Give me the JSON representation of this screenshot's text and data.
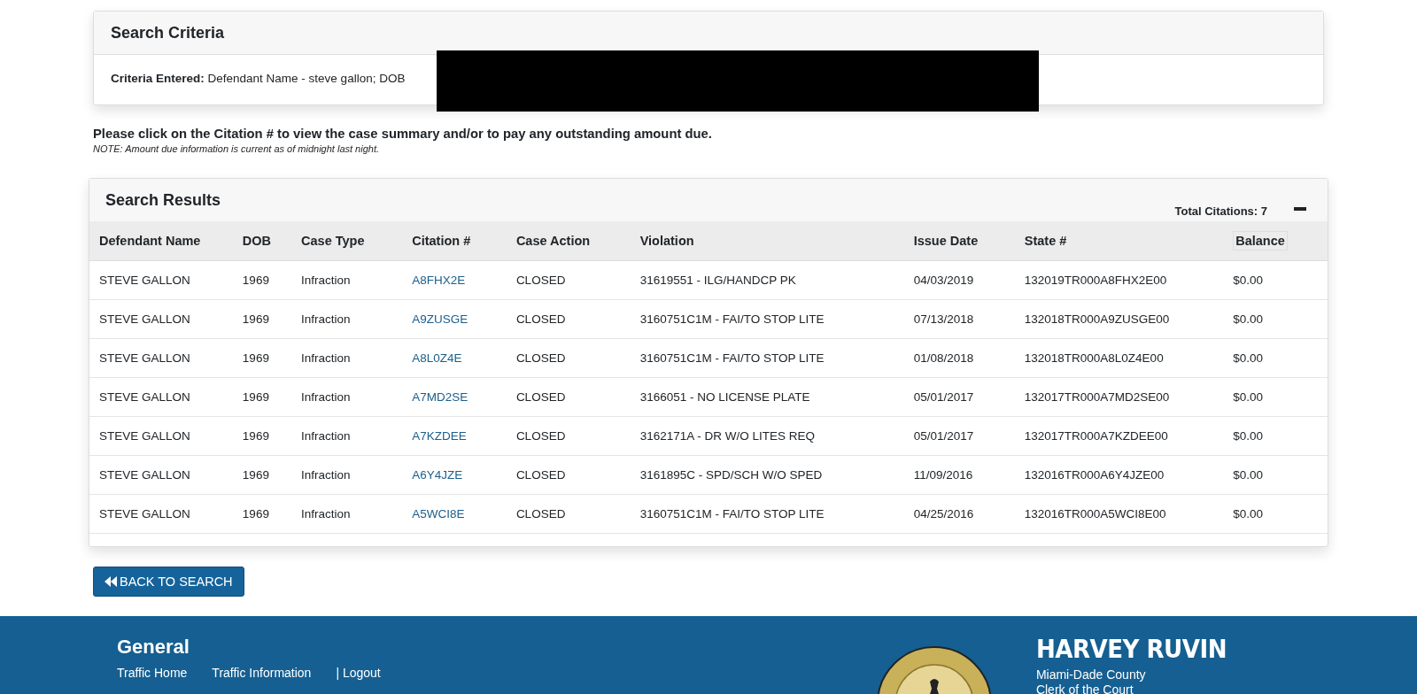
{
  "criteria": {
    "title": "Search Criteria",
    "label": "Criteria Entered:",
    "value": "Defendant Name - steve gallon; DOB"
  },
  "instructions": "Please click on the Citation # to view the case summary and/or to pay any outstanding amount due.",
  "note": "NOTE: Amount due information is current as of midnight last night.",
  "results": {
    "title": "Search Results",
    "total": "Total Citations: 7",
    "expanded": true,
    "columns": [
      "Defendant Name",
      "DOB",
      "Case Type",
      "Citation #",
      "Case Action",
      "Violation",
      "Issue Date",
      "State #",
      "Balance"
    ],
    "rows": [
      [
        "STEVE GALLON",
        "1969",
        "Infraction",
        "A8FHX2E",
        "CLOSED",
        "31619551 - ILG/HANDCP PK",
        "04/03/2019",
        "132019TR000A8FHX2E00",
        "$0.00"
      ],
      [
        "STEVE GALLON",
        "1969",
        "Infraction",
        "A9ZUSGE",
        "CLOSED",
        "3160751C1M - FAI/TO STOP LITE",
        "07/13/2018",
        "132018TR000A9ZUSGE00",
        "$0.00"
      ],
      [
        "STEVE GALLON",
        "1969",
        "Infraction",
        "A8L0Z4E",
        "CLOSED",
        "3160751C1M - FAI/TO STOP LITE",
        "01/08/2018",
        "132018TR000A8L0Z4E00",
        "$0.00"
      ],
      [
        "STEVE GALLON",
        "1969",
        "Infraction",
        "A7MD2SE",
        "CLOSED",
        "3166051 - NO LICENSE PLATE",
        "05/01/2017",
        "132017TR000A7MD2SE00",
        "$0.00"
      ],
      [
        "STEVE GALLON",
        "1969",
        "Infraction",
        "A7KZDEE",
        "CLOSED",
        "3162171A - DR W/O LITES REQ",
        "05/01/2017",
        "132017TR000A7KZDEE00",
        "$0.00"
      ],
      [
        "STEVE GALLON",
        "1969",
        "Infraction",
        "A6Y4JZE",
        "CLOSED",
        "3161895C - SPD/SCH W/O SPED",
        "11/09/2016",
        "132016TR000A6Y4JZE00",
        "$0.00"
      ],
      [
        "STEVE GALLON",
        "1969",
        "Infraction",
        "A5WCI8E",
        "CLOSED",
        "3160751C1M - FAI/TO STOP LITE",
        "04/25/2016",
        "132016TR000A5WCI8E00",
        "$0.00"
      ]
    ]
  },
  "back_button": "BACK TO SEARCH",
  "footer": {
    "heading": "General",
    "links": [
      "Traffic Home",
      "Traffic Information",
      "| Logout"
    ],
    "name": "HARVEY RUVIN",
    "lines": [
      "Miami-Dade County",
      "Clerk of the Court"
    ]
  }
}
